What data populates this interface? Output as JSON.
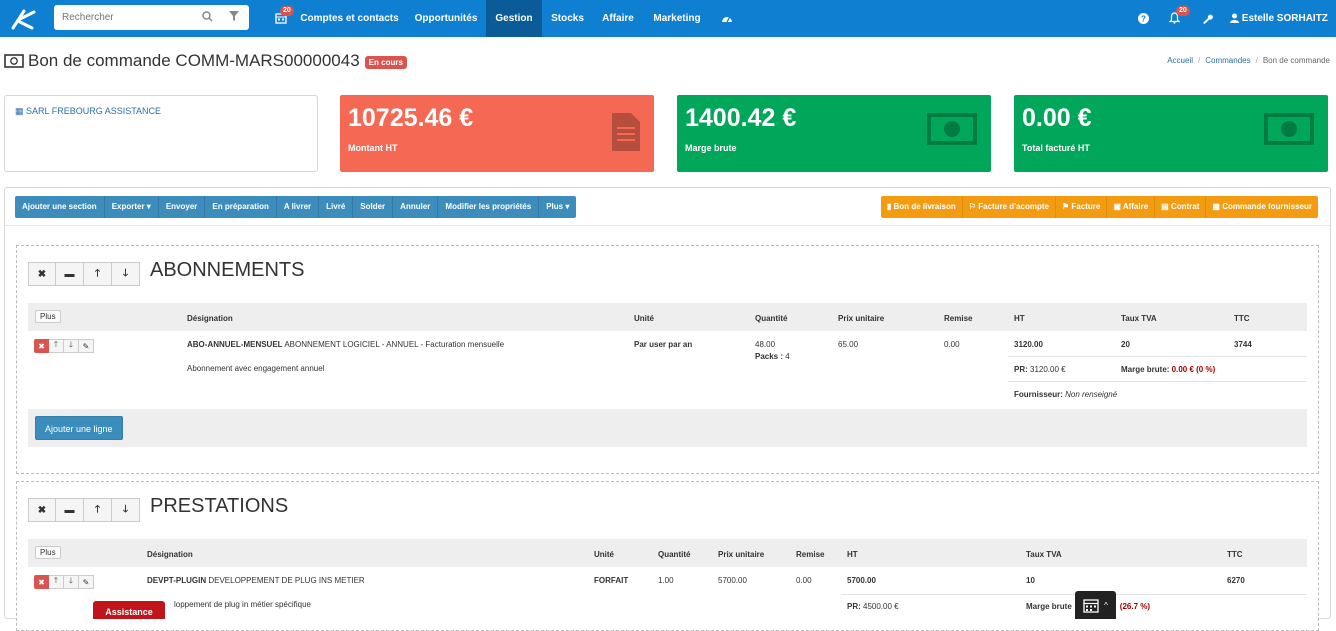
{
  "nav": {
    "search_placeholder": "Rechercher",
    "calendar_badge": "20",
    "items": [
      "Comptes et contacts",
      "Opportunités",
      "Gestion",
      "Stocks",
      "Affaire",
      "Marketing"
    ],
    "notif_badge": "20",
    "user": "Estelle SORHAITZ"
  },
  "header": {
    "title": "Bon de commande COMM-MARS00000043",
    "status": "En cours",
    "breadcrumb": [
      "Accueil",
      "Commandes",
      "Bon de commande"
    ]
  },
  "client": {
    "name": "SARL FREBOURG ASSISTANCE"
  },
  "kpis": [
    {
      "value": "10725.46 €",
      "label": "Montant HT",
      "color": "#f56954"
    },
    {
      "value": "1400.42 €",
      "label": "Marge brute",
      "color": "#00a65a"
    },
    {
      "value": "0.00 €",
      "label": "Total facturé HT",
      "color": "#00a65a"
    }
  ],
  "toolbar": {
    "left": [
      "Ajouter une section",
      "Exporter ▾",
      "Envoyer",
      "En préparation",
      "A livrer",
      "Livré",
      "Solder",
      "Annuler",
      "Modifier les propriétés",
      "Plus ▾"
    ],
    "right": [
      "Bon de livraison",
      "Facture d'acompte",
      "Facture",
      "Affaire",
      "Contrat",
      "Commande fournisseur"
    ]
  },
  "sections": [
    {
      "title": "ABONNEMENTS",
      "plus": "Plus",
      "headers": [
        "Désignation",
        "Unité",
        "Quantité",
        "Prix unitaire",
        "Remise",
        "HT",
        "Taux TVA",
        "TTC"
      ],
      "line": {
        "code": "ABO-ANNUEL-MENSUEL",
        "label": " ABONNEMENT LOGICIEL - ANNUEL - Facturation mensuelle",
        "desc": "Abonnement avec engagement annuel",
        "unit": "Par user par an",
        "qty": "48.00",
        "packs_label": "Packs : ",
        "packs": "4",
        "price": "65.00",
        "discount": "0.00",
        "ht": "3120.00",
        "tva": "20",
        "ttc": "3744",
        "pr_label": "PR: ",
        "pr": "3120.00 €",
        "marge_label": "Marge brute: ",
        "marge": "0.00 € (0 %)",
        "fournisseur_label": "Fournisseur: ",
        "fournisseur": "Non renseigné"
      },
      "add_line": "Ajouter une ligne"
    },
    {
      "title": "PRESTATIONS",
      "plus": "Plus",
      "headers": [
        "Désignation",
        "Unité",
        "Quantité",
        "Prix unitaire",
        "Remise",
        "HT",
        "Taux TVA",
        "TTC"
      ],
      "line": {
        "code": "DEVPT-PLUGIN",
        "label": " DEVELOPPEMENT DE PLUG INS METIER",
        "desc": "loppement de plug in métier spécifique",
        "unit": "FORFAIT",
        "qty": "1.00",
        "price": "5700.00",
        "discount": "0.00",
        "ht": "5700.00",
        "tva": "10",
        "ttc": "6270",
        "pr_label": "PR: ",
        "pr": "4500.00 €",
        "marge_label": "Marge brute",
        "marge": "(26.7 %)"
      }
    }
  ],
  "assistance": "Assistance"
}
